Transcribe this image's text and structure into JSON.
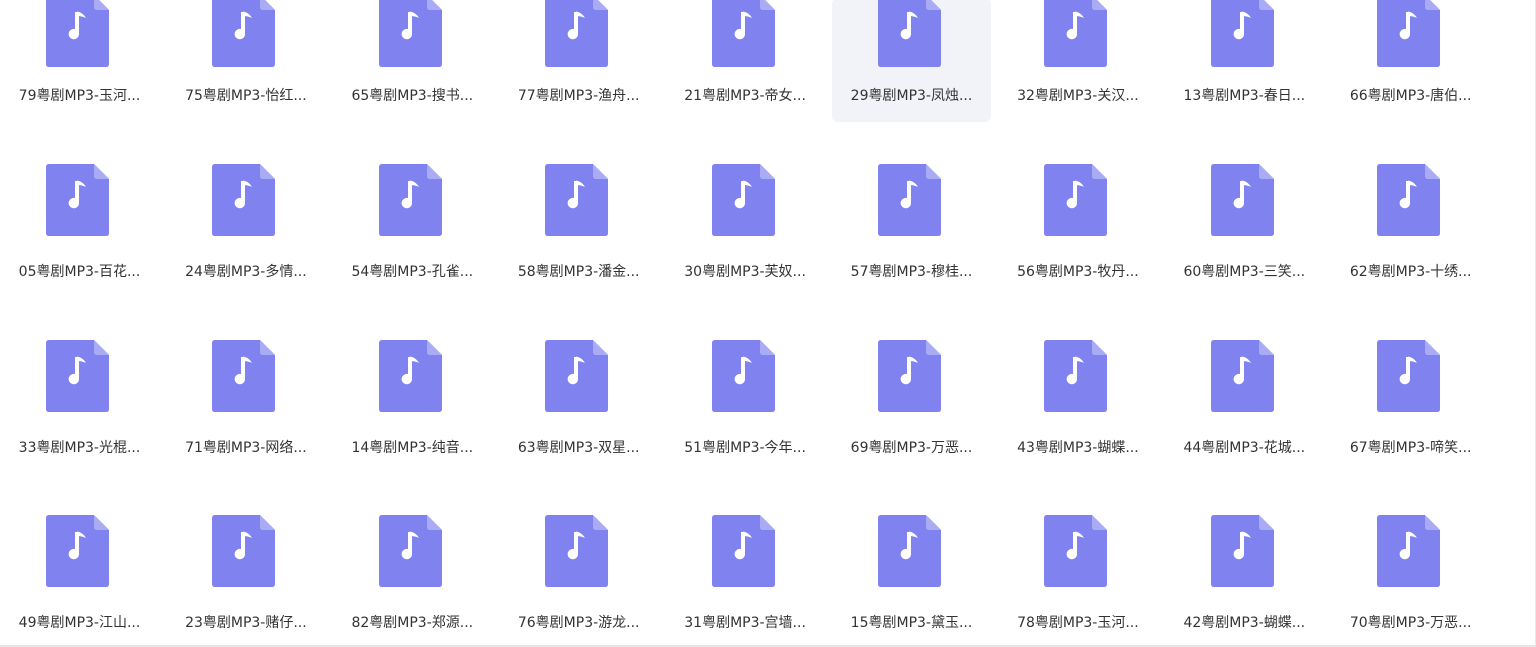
{
  "icon": {
    "name": "music-file-icon",
    "body_color": "#8082ef",
    "fold_color": "#a9acf5",
    "note_color": "#ffffff"
  },
  "selected_index": 5,
  "files": [
    "79粤剧MP3-玉河...",
    "75粤剧MP3-怡红...",
    "65粤剧MP3-搜书...",
    "77粤剧MP3-渔舟...",
    "21粤剧MP3-帝女...",
    "29粤剧MP3-凤烛...",
    "32粤剧MP3-关汉...",
    "13粤剧MP3-春日...",
    "66粤剧MP3-唐伯...",
    "05粤剧MP3-百花...",
    "24粤剧MP3-多情...",
    "54粤剧MP3-孔雀...",
    "58粤剧MP3-潘金...",
    "30粤剧MP3-芙奴...",
    "57粤剧MP3-穆桂...",
    "56粤剧MP3-牧丹...",
    "60粤剧MP3-三笑...",
    "62粤剧MP3-十绣...",
    "33粤剧MP3-光棍...",
    "71粤剧MP3-网络...",
    "14粤剧MP3-纯音...",
    "63粤剧MP3-双星...",
    "51粤剧MP3-今年...",
    "69粤剧MP3-万恶...",
    "43粤剧MP3-蝴蝶...",
    "44粤剧MP3-花城...",
    "67粤剧MP3-啼笑...",
    "49粤剧MP3-江山...",
    "23粤剧MP3-赌仔...",
    "82粤剧MP3-郑源...",
    "76粤剧MP3-游龙...",
    "31粤剧MP3-宫墙...",
    "15粤剧MP3-黛玉...",
    "78粤剧MP3-玉河...",
    "42粤剧MP3-蝴蝶...",
    "70粤剧MP3-万恶..."
  ]
}
